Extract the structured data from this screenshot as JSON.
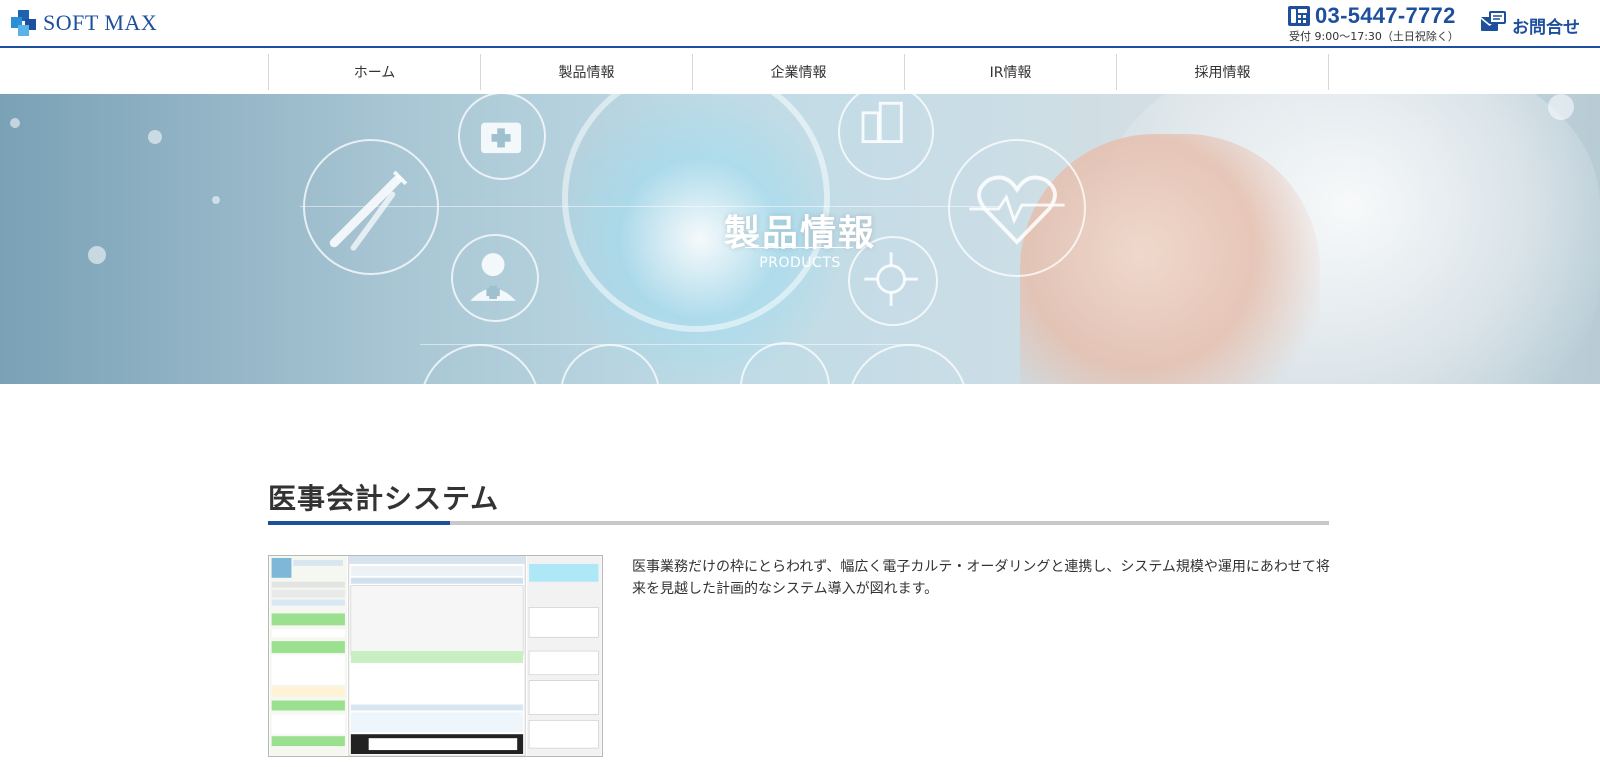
{
  "header": {
    "logo_text": "SOFT MAX",
    "phone_number": "03-5447-7772",
    "hours": "受付 9:00〜17:30（土日祝除く）",
    "contact_label": "お問合せ"
  },
  "nav": {
    "items": [
      {
        "label": "ホーム"
      },
      {
        "label": "製品情報"
      },
      {
        "label": "企業情報"
      },
      {
        "label": "IR情報"
      },
      {
        "label": "採用情報"
      }
    ]
  },
  "hero": {
    "title": "製品情報",
    "subtitle": "PRODUCTS"
  },
  "section": {
    "title": "医事会計システム",
    "description": "医事業務だけの枠にとらわれず、幅広く電子カルテ・オーダリングと連携し、システム規模や運用にあわせて将来を見越した計画的なシステム導入が図れます。"
  },
  "colors": {
    "brand": "#1d4f9c",
    "rule_gray": "#c8c8c8"
  }
}
